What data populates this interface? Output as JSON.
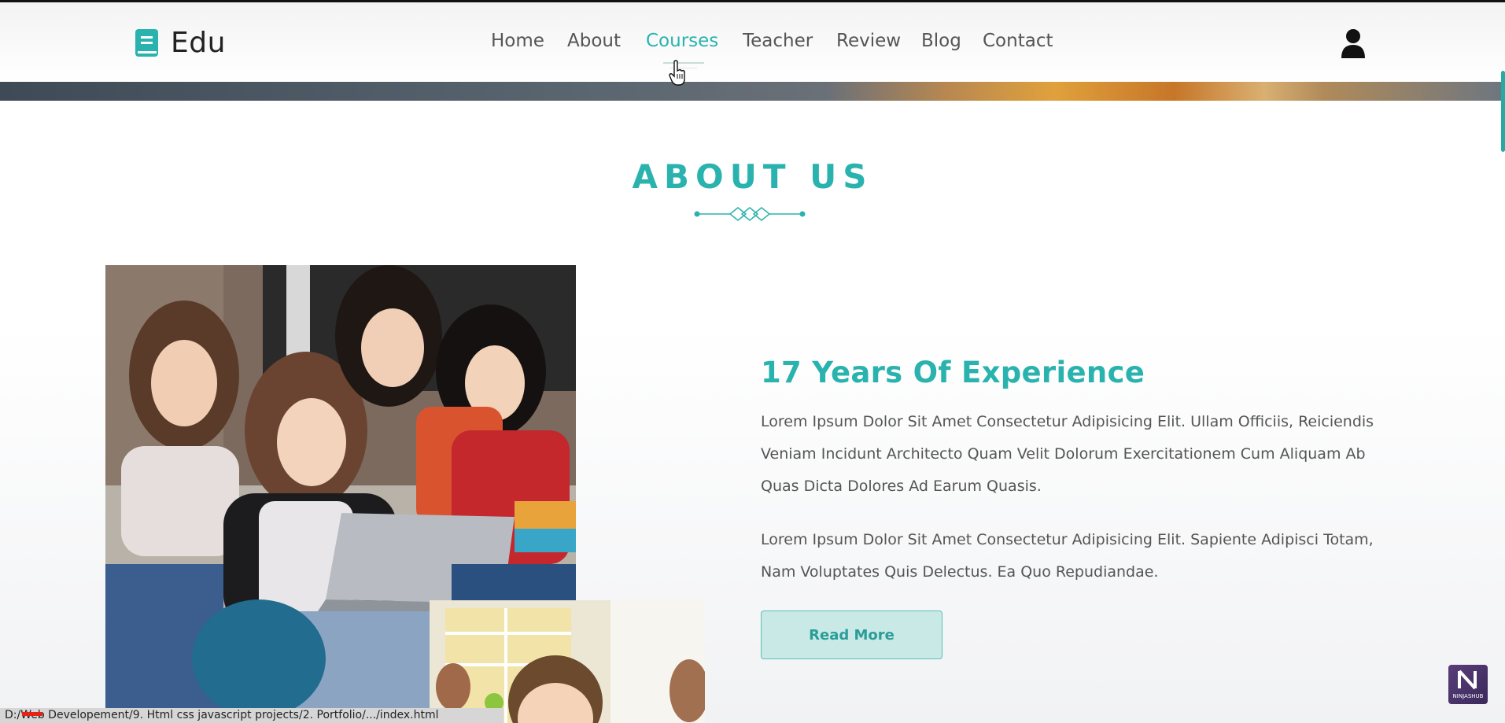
{
  "header": {
    "logo_text": "Edu",
    "nav": [
      {
        "label": "Home"
      },
      {
        "label": "About"
      },
      {
        "label": "Courses",
        "active": true
      },
      {
        "label": "Teacher"
      },
      {
        "label": "Review"
      },
      {
        "label": "Blog"
      },
      {
        "label": "Contact"
      }
    ]
  },
  "about": {
    "heading": "ABOUT US",
    "title": "17 Years Of Experience",
    "paragraph1": "Lorem Ipsum Dolor Sit Amet Consectetur Adipisicing Elit. Ullam Officiis, Reiciendis Veniam Incidunt Architecto Quam Velit Dolorum Exercitationem Cum Aliquam Ab Quas Dicta Dolores Ad Earum Quasis.",
    "paragraph2": "Lorem Ipsum Dolor Sit Amet Consectetur Adipisicing Elit. Sapiente Adipisci Totam, Nam Voluptates Quis Delectus. Ea Quo Repudiandae.",
    "button_label": "Read More"
  },
  "status_bar": {
    "url": "D:/Web Developement/9. Html css javascript projects/2. Portfolio/.../index.html"
  },
  "watermark": {
    "text": "NINJASHUB"
  },
  "colors": {
    "accent": "#2ab3ae",
    "button_bg": "#c9e9e7",
    "text": "#555555"
  }
}
